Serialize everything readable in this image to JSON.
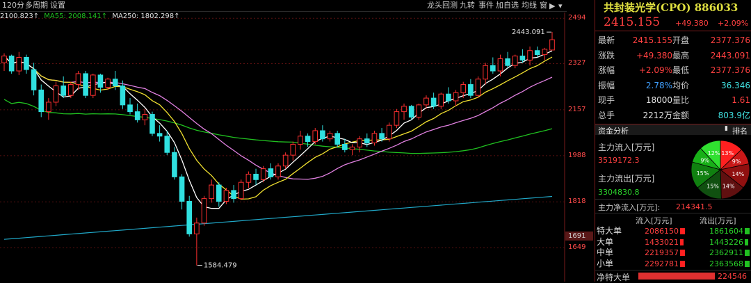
{
  "toolbar": {
    "period": "120分",
    "multi_period": "多周期",
    "settings": "设置",
    "dragon_tiger": "龙头回测",
    "nine_turn": "九转",
    "events": "事件",
    "add_watchlist": "加自选",
    "ma_line": "均线",
    "window": "窗",
    "icons": [
      "play-icon",
      "chevron-down-icon",
      "eye-icon",
      "eye-icon",
      "calendar-icon",
      "hand-icon",
      "lock-icon",
      "help-icon",
      "plus-circle-icon",
      "close-circle-icon"
    ]
  },
  "ma_legend": {
    "ma_short": "2100.823↑",
    "ma55": "MA55: 2008.141↑",
    "ma250": "MA250: 1802.298↑"
  },
  "chart_data": {
    "type": "candlestick",
    "ylim": [
      1550,
      2510
    ],
    "y_ticks": [
      {
        "label": "2494",
        "value": 2494
      },
      {
        "label": "2327",
        "value": 2327
      },
      {
        "label": "2157",
        "value": 2157
      },
      {
        "label": "1988",
        "value": 1988
      },
      {
        "label": "1818",
        "value": 1818
      },
      {
        "label": "1649",
        "value": 1649
      }
    ],
    "current_marker": {
      "label": "1691",
      "value": 1691
    },
    "max_annotation": "2443.091",
    "min_annotation": "1584.479",
    "max_value": 2443.091,
    "min_value": 1584.479,
    "series_colors": {
      "ma_white": "#ffffff",
      "ma_yellow": "#f0e030",
      "ma_pink": "#e080e0",
      "ma55_green": "#20c020",
      "ma250_cyan": "#20a8c8",
      "up": "#ff3030",
      "down": "#30e0e0"
    },
    "ohlc": [
      [
        2330,
        2365,
        2300,
        2355
      ],
      [
        2355,
        2360,
        2290,
        2300
      ],
      [
        2300,
        2370,
        2285,
        2350
      ],
      [
        2350,
        2360,
        2290,
        2305
      ],
      [
        2305,
        2330,
        2210,
        2230
      ],
      [
        2230,
        2250,
        2130,
        2150
      ],
      [
        2150,
        2200,
        2120,
        2185
      ],
      [
        2185,
        2260,
        2170,
        2245
      ],
      [
        2245,
        2280,
        2200,
        2210
      ],
      [
        2210,
        2260,
        2200,
        2250
      ],
      [
        2250,
        2300,
        2230,
        2290
      ],
      [
        2290,
        2300,
        2200,
        2210
      ],
      [
        2210,
        2290,
        2200,
        2285
      ],
      [
        2285,
        2290,
        2220,
        2240
      ],
      [
        2240,
        2275,
        2230,
        2270
      ],
      [
        2270,
        2300,
        2230,
        2245
      ],
      [
        2245,
        2265,
        2160,
        2175
      ],
      [
        2175,
        2200,
        2140,
        2150
      ],
      [
        2150,
        2180,
        2110,
        2120
      ],
      [
        2120,
        2160,
        2100,
        2140
      ],
      [
        2140,
        2150,
        2060,
        2070
      ],
      [
        2070,
        2100,
        2040,
        2060
      ],
      [
        2060,
        2080,
        1990,
        2000
      ],
      [
        2000,
        2020,
        1900,
        1910
      ],
      [
        1910,
        1920,
        1790,
        1820
      ],
      [
        1820,
        1840,
        1690,
        1700
      ],
      [
        1700,
        1760,
        1584,
        1740
      ],
      [
        1740,
        1840,
        1730,
        1830
      ],
      [
        1830,
        1900,
        1815,
        1880
      ],
      [
        1880,
        1890,
        1800,
        1820
      ],
      [
        1820,
        1870,
        1810,
        1860
      ],
      [
        1860,
        1880,
        1815,
        1830
      ],
      [
        1830,
        1900,
        1825,
        1890
      ],
      [
        1890,
        1930,
        1870,
        1920
      ],
      [
        1920,
        1940,
        1880,
        1900
      ],
      [
        1900,
        1950,
        1890,
        1940
      ],
      [
        1940,
        1960,
        1900,
        1910
      ],
      [
        1910,
        1960,
        1900,
        1950
      ],
      [
        1950,
        2000,
        1940,
        1990
      ],
      [
        1990,
        2040,
        1970,
        2030
      ],
      [
        2030,
        2080,
        2010,
        2060
      ],
      [
        2060,
        2070,
        2020,
        2040
      ],
      [
        2040,
        2090,
        2030,
        2080
      ],
      [
        2080,
        2100,
        2040,
        2050
      ],
      [
        2050,
        2080,
        2040,
        2070
      ],
      [
        2070,
        2080,
        2020,
        2030
      ],
      [
        2030,
        2050,
        2000,
        2010
      ],
      [
        2010,
        2030,
        1990,
        2020
      ],
      [
        2020,
        2060,
        2000,
        2050
      ],
      [
        2050,
        2070,
        2020,
        2035
      ],
      [
        2035,
        2080,
        2025,
        2070
      ],
      [
        2070,
        2090,
        2040,
        2050
      ],
      [
        2050,
        2110,
        2040,
        2100
      ],
      [
        2100,
        2160,
        2090,
        2150
      ],
      [
        2150,
        2180,
        2120,
        2170
      ],
      [
        2170,
        2175,
        2120,
        2130
      ],
      [
        2130,
        2180,
        2120,
        2175
      ],
      [
        2175,
        2210,
        2160,
        2200
      ],
      [
        2200,
        2220,
        2160,
        2170
      ],
      [
        2170,
        2220,
        2160,
        2215
      ],
      [
        2215,
        2240,
        2180,
        2190
      ],
      [
        2190,
        2230,
        2170,
        2220
      ],
      [
        2220,
        2260,
        2200,
        2250
      ],
      [
        2250,
        2270,
        2200,
        2210
      ],
      [
        2210,
        2280,
        2200,
        2270
      ],
      [
        2270,
        2330,
        2250,
        2320
      ],
      [
        2320,
        2350,
        2290,
        2300
      ],
      [
        2300,
        2360,
        2280,
        2345
      ],
      [
        2345,
        2370,
        2310,
        2320
      ],
      [
        2320,
        2360,
        2310,
        2355
      ],
      [
        2355,
        2380,
        2330,
        2340
      ],
      [
        2340,
        2390,
        2320,
        2375
      ],
      [
        2375,
        2390,
        2350,
        2360
      ],
      [
        2360,
        2385,
        2340,
        2380
      ],
      [
        2377,
        2443,
        2377,
        2415
      ]
    ]
  },
  "stock": {
    "name": "共封装光学(CPO)",
    "code": "886033",
    "price": "2415.155",
    "change": "+49.380",
    "change_pct": "+2.09%"
  },
  "quote": [
    {
      "l1": "最新",
      "v1": "2415.155",
      "l2": "开盘",
      "v2": "2377.376",
      "c1": "#ff4040",
      "c2": "#ff4040"
    },
    {
      "l1": "涨跌",
      "v1": "+49.380",
      "l2": "最高",
      "v2": "2443.091",
      "c1": "#ff4040",
      "c2": "#ff4040"
    },
    {
      "l1": "涨幅",
      "v1": "+2.09%",
      "l2": "最低",
      "v2": "2377.376",
      "c1": "#ff4040",
      "c2": "#ff4040"
    },
    {
      "l1": "振幅",
      "v1": "2.78%",
      "l2": "均价",
      "v2": "36.346",
      "c1": "#40a0ff",
      "c2": "#40e0e0"
    },
    {
      "l1": "现手",
      "v1": "18000",
      "l2": "量比",
      "v2": "1.61",
      "c1": "#e0e0e0",
      "c2": "#ff4040"
    },
    {
      "l1": "总手",
      "v1": "2212万",
      "l2": "金额",
      "v2": "803.9亿",
      "c1": "#e0e0e0",
      "c2": "#40e0e0"
    }
  ],
  "fund": {
    "header": "资金分析",
    "rank_label": "排名",
    "main_in_label": "主力流入[万元]",
    "main_in": "3519172.3",
    "main_out_label": "主力流出[万元]",
    "main_out": "3304830.8",
    "net_label": "主力净流入[万元]:",
    "net_value": "214341.5",
    "col_in": "流入[万元]",
    "col_out": "流出[万元]",
    "pie": [
      {
        "label": "13%",
        "value": 13,
        "color": "#ff2020"
      },
      {
        "label": "9%",
        "value": 9,
        "color": "#c81818"
      },
      {
        "label": "14%",
        "value": 14,
        "color": "#901010"
      },
      {
        "label": "14%",
        "value": 14,
        "color": "#601010"
      },
      {
        "label": "15%",
        "value": 15,
        "color": "#105010"
      },
      {
        "label": "15%",
        "value": 15,
        "color": "#108010"
      },
      {
        "label": "9%",
        "value": 9,
        "color": "#18b018"
      },
      {
        "label": "12%",
        "value": 12,
        "color": "#30e030"
      }
    ],
    "rows": [
      {
        "label": "特大单",
        "in": "2086150",
        "out": "1861604",
        "in_frac": 1.0,
        "out_frac": 1.0
      },
      {
        "label": "大单",
        "in": "1433021",
        "out": "1443226",
        "in_frac": 0.7,
        "out_frac": 0.75
      },
      {
        "label": "中单",
        "in": "2219357",
        "out": "2362911",
        "in_frac": 1.0,
        "out_frac": 1.0
      },
      {
        "label": "小单",
        "in": "2292781",
        "out": "2363568",
        "in_frac": 1.0,
        "out_frac": 1.0
      }
    ],
    "net_big_label": "净特大单",
    "net_big_value": "224546"
  }
}
